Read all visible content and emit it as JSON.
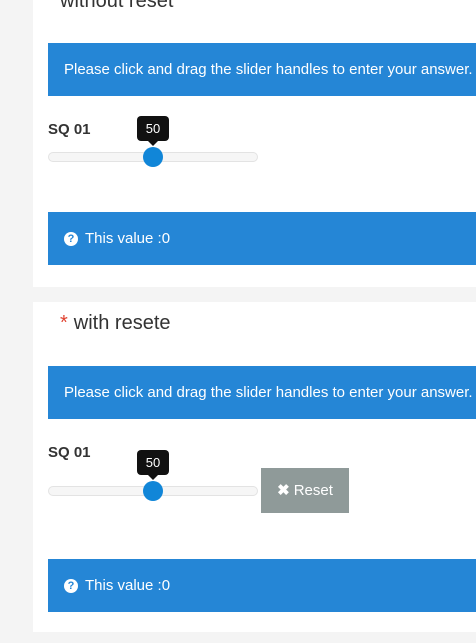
{
  "questions": [
    {
      "title": "without reset",
      "required": false,
      "help_text": "Please click and drag the slider handles to enter your answer.",
      "subquestion": "SQ 01",
      "slider_value": "50",
      "slider_fraction": 0.5,
      "value_text": "This value :0",
      "has_reset": false
    },
    {
      "title": "with resete",
      "required": true,
      "required_mark": "*",
      "help_text": "Please click and drag the slider handles to enter your answer.",
      "subquestion": "SQ 01",
      "slider_value": "50",
      "slider_fraction": 0.5,
      "value_text": "This value :0",
      "has_reset": true,
      "reset_label": "Reset"
    }
  ],
  "icons": {
    "help": "question-circle-icon",
    "reset": "close-icon"
  },
  "colors": {
    "accent": "#2586d6",
    "handle": "#1186d8",
    "reset_button": "#8f9a99",
    "required": "#e0412f"
  }
}
